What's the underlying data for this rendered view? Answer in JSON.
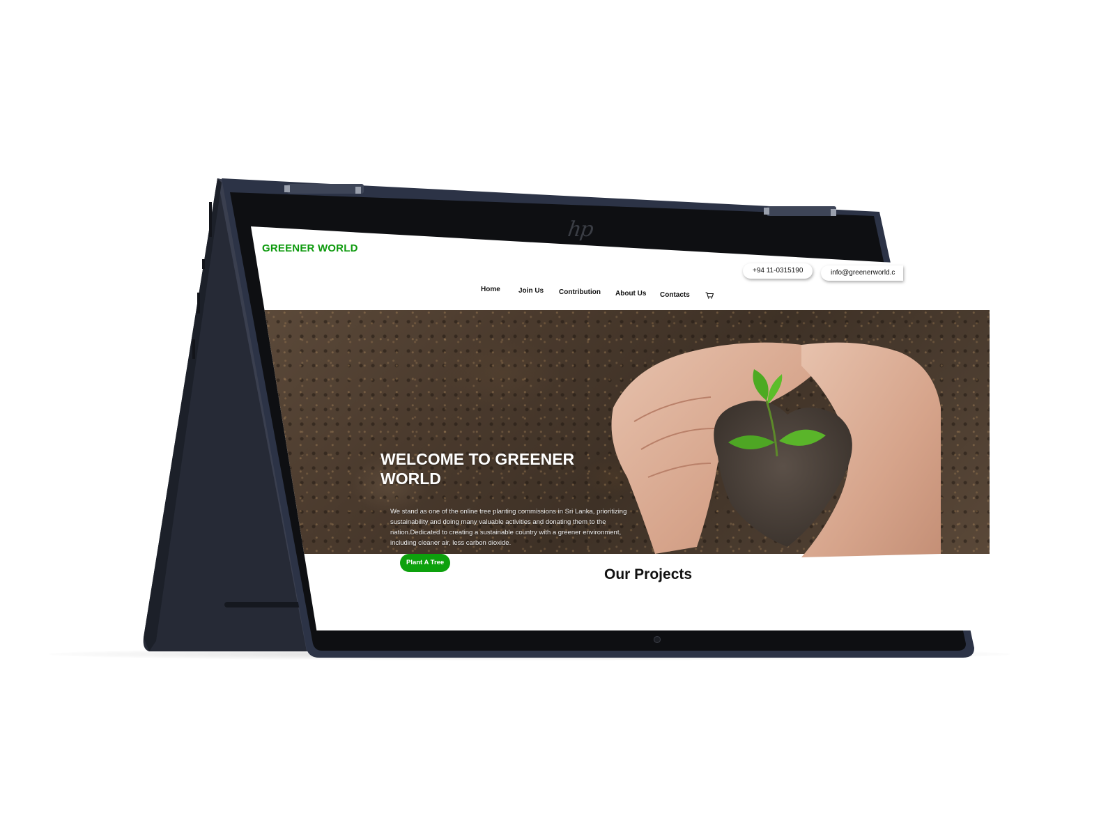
{
  "site": {
    "brand": "GREENER WORLD",
    "accent_color": "#0d9a0d"
  },
  "contact": {
    "phone": "+94 11-0315190",
    "email": "info@greenerworld.c"
  },
  "nav": {
    "items": [
      {
        "label": "Home"
      },
      {
        "label": "Join Us"
      },
      {
        "label": "Contribution"
      },
      {
        "label": "About Us"
      },
      {
        "label": "Contacts"
      }
    ],
    "cart_icon": "cart-icon"
  },
  "hero": {
    "title": "WELCOME TO GREENER WORLD",
    "paragraph": "We stand as one of the online tree planting commissions in Sri Lanka, prioritizing sustainability and doing many valuable activities and donating them to the nation.Dedicated to creating a sustainable country with a greener environment, including cleaner air, less carbon dioxide.",
    "cta_label": "Plant A Tree"
  },
  "projects": {
    "title": "Our Projects"
  },
  "device": {
    "logo_text": "hp"
  }
}
